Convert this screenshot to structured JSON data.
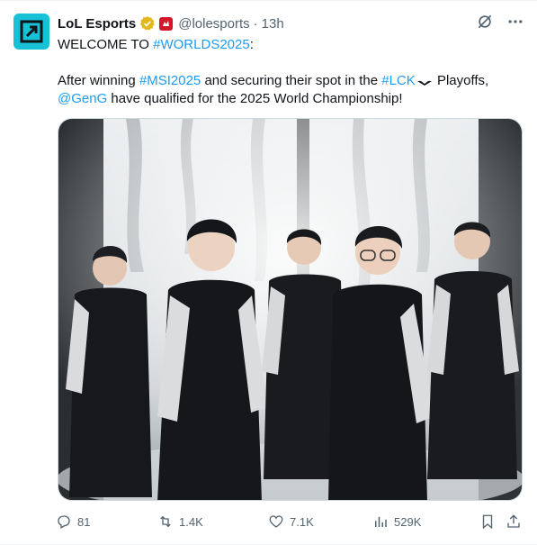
{
  "author": {
    "name": "LoL Esports",
    "handle": "@lolesports",
    "separator": "·",
    "time": "13h"
  },
  "tweet": {
    "line1_prefix": "WELCOME TO ",
    "line1_hashtag": "#WORLDS2025",
    "line1_suffix": ":",
    "line2_a": "After winning ",
    "line2_hashtag1": "#MSI2025",
    "line2_b": " and securing their spot in the ",
    "line2_hashtag2": "#LCK",
    "line2_c": " Playoffs,",
    "line3_mention": "@GenG",
    "line3_rest": " have qualified for the 2025 World Championship!"
  },
  "metrics": {
    "replies": "81",
    "reposts": "1.4K",
    "likes": "7.1K",
    "views": "529K"
  },
  "colors": {
    "link": "#1d9bf0",
    "avatar_bg": "#17c2d6",
    "muted": "#536471",
    "verified_gold": "#e2b719"
  },
  "icons": [
    "grok-icon",
    "more-icon",
    "verified-badge-icon",
    "affiliate-badge-icon",
    "reply-icon",
    "repost-icon",
    "like-icon",
    "views-icon",
    "bookmark-icon",
    "share-icon"
  ]
}
